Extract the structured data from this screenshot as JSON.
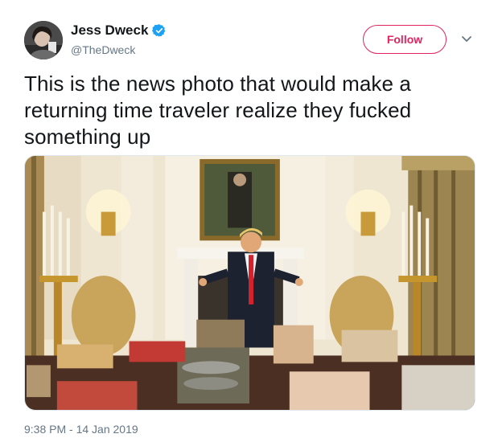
{
  "author": {
    "display_name": "Jess Dweck",
    "handle": "@TheDweck",
    "verified_icon": "verified-badge-icon",
    "avatar_icon": "avatar"
  },
  "actions": {
    "follow_label": "Follow",
    "more_icon": "chevron-down-icon"
  },
  "tweet": {
    "text": "This is the news photo that would make a returning time traveler realize they fucked something up",
    "timestamp": "9:38 PM - 14 Jan 2019"
  },
  "colors": {
    "follow_accent": "#e0245e",
    "verified_blue": "#1da1f2",
    "secondary_text": "#657786"
  }
}
